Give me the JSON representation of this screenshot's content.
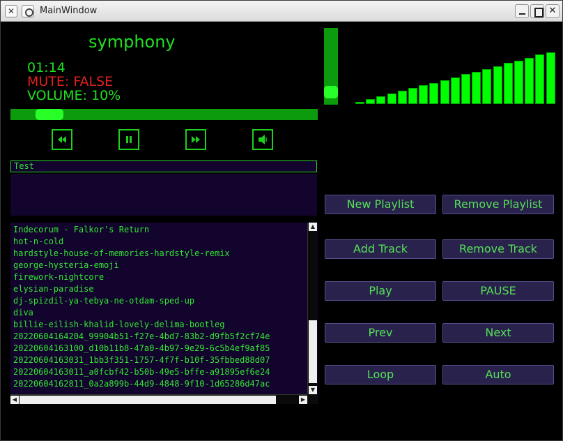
{
  "window": {
    "title": "MainWindow",
    "app_icon": "x-logo-icon",
    "controls": [
      "minimize-icon",
      "maximize-icon",
      "close-icon"
    ]
  },
  "player": {
    "track_title": "symphony",
    "time": "01:14",
    "mute_status": "MUTE: FALSE",
    "volume_status": "VOLUME: 10%",
    "progress_fraction": 0.09,
    "volume_fraction": 0.1
  },
  "transport": {
    "icons": [
      "rewind-icon",
      "pause-icon",
      "fast-forward-icon",
      "speaker-icon"
    ]
  },
  "playlist_name_input": {
    "value": "Test"
  },
  "tracks": [
    "Indecorum - Falkor's Return",
    "hot-n-cold",
    "hardstyle-house-of-memories-hardstyle-remix",
    "george-hysteria-emoji",
    "firework-nightcore",
    "elysian-paradise",
    "dj-spizdil-ya-tebya-ne-otdam-sped-up",
    "diva",
    "billie-eilish-khalid-lovely-delima-bootleg",
    "20220604164204_99904b51-f27e-4bd7-83b2-d9fb5f2cf74e",
    "20220604163100_d10b11b8-47a0-4b97-9e29-6c5b4ef9af85",
    "20220604163031_1bb3f351-1757-4f7f-b10f-35fbbed88d07",
    "20220604163011_a0fcbf42-b50b-49e5-bffe-a91895ef6e24",
    "20220604162811_0a2a899b-44d9-4848-9f10-1d65286d47ac"
  ],
  "visualizer_levels": [
    0.04,
    0.09,
    0.15,
    0.2,
    0.25,
    0.3,
    0.35,
    0.4,
    0.45,
    0.5,
    0.56,
    0.61,
    0.66,
    0.71,
    0.77,
    0.82,
    0.87,
    0.93,
    0.98
  ],
  "buttons": {
    "new_playlist": "New Playlist",
    "remove_playlist": "Remove Playlist",
    "add_track": "Add Track",
    "remove_track": "Remove Track",
    "play": "Play",
    "pause": "PAUSE",
    "prev": "Prev",
    "next": "Next",
    "loop": "Loop",
    "auto": "Auto"
  },
  "colors": {
    "accent_green": "#20e020",
    "mute_red": "#e02020",
    "panel_bg": "#13042e",
    "button_bg": "#29224d"
  }
}
